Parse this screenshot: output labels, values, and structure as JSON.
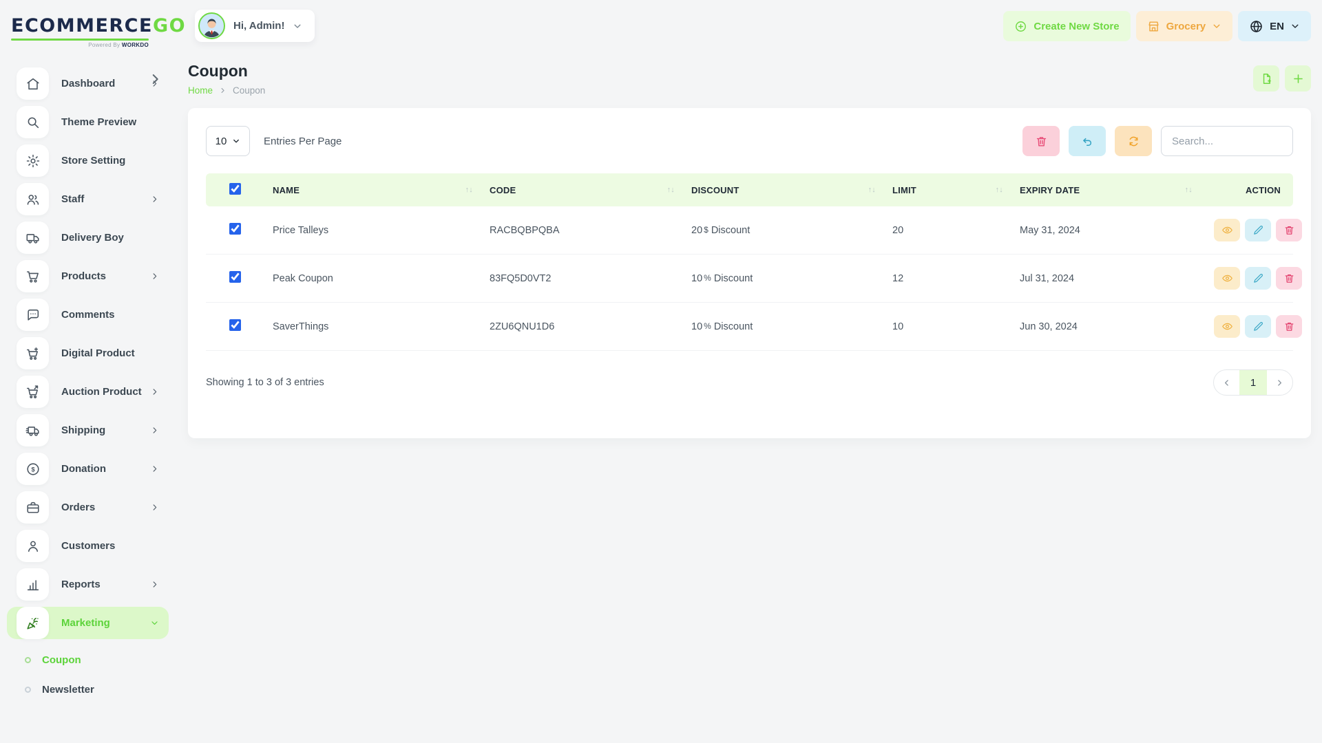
{
  "brand": {
    "name_primary": "ECOMMERCE",
    "name_accent": "GO",
    "powered_prefix": "Powered By ",
    "powered_name": "WORKDO"
  },
  "topbar": {
    "greeting": "Hi, Admin!",
    "create_store_label": "Create New Store",
    "store_selector_label": "Grocery",
    "language_label": "EN"
  },
  "sidebar": {
    "items": [
      {
        "label": "Dashboard",
        "icon": "home",
        "chevron": true,
        "active": false
      },
      {
        "label": "Theme Preview",
        "icon": "search",
        "chevron": false,
        "active": false
      },
      {
        "label": "Store Setting",
        "icon": "gear",
        "chevron": false,
        "active": false
      },
      {
        "label": "Staff",
        "icon": "users",
        "chevron": true,
        "active": false
      },
      {
        "label": "Delivery Boy",
        "icon": "truck",
        "chevron": false,
        "active": false
      },
      {
        "label": "Products",
        "icon": "cart",
        "chevron": true,
        "active": false
      },
      {
        "label": "Comments",
        "icon": "chat",
        "chevron": false,
        "active": false
      },
      {
        "label": "Digital Product",
        "icon": "cart-plus",
        "chevron": false,
        "active": false
      },
      {
        "label": "Auction Product",
        "icon": "cart-arrow",
        "chevron": true,
        "active": false
      },
      {
        "label": "Shipping",
        "icon": "truck-fast",
        "chevron": true,
        "active": false
      },
      {
        "label": "Donation",
        "icon": "dollar-circle",
        "chevron": true,
        "active": false
      },
      {
        "label": "Orders",
        "icon": "briefcase",
        "chevron": true,
        "active": false
      },
      {
        "label": "Customers",
        "icon": "user",
        "chevron": false,
        "active": false
      },
      {
        "label": "Reports",
        "icon": "bar-chart",
        "chevron": true,
        "active": false
      },
      {
        "label": "Marketing",
        "icon": "party",
        "chevron": true,
        "active": true
      }
    ],
    "subitems": [
      {
        "label": "Coupon",
        "active": true
      },
      {
        "label": "Newsletter",
        "active": false
      }
    ]
  },
  "page": {
    "title": "Coupon",
    "breadcrumb_home": "Home",
    "breadcrumb_current": "Coupon"
  },
  "toolbar": {
    "entries_value": "10",
    "entries_label": "Entries Per Page",
    "search_placeholder": "Search..."
  },
  "table": {
    "headers": [
      {
        "label": "NAME",
        "sortable": true
      },
      {
        "label": "CODE",
        "sortable": true
      },
      {
        "label": "DISCOUNT",
        "sortable": true
      },
      {
        "label": "LIMIT",
        "sortable": true
      },
      {
        "label": "EXPIRY DATE",
        "sortable": true
      },
      {
        "label": "ACTION",
        "sortable": false
      }
    ],
    "rows": [
      {
        "name": "Price Talleys",
        "code": "RACBQBPQBA",
        "discount_value": "20",
        "discount_symbol": "$",
        "discount_text": "Discount",
        "limit": "20",
        "expiry": "May 31, 2024"
      },
      {
        "name": "Peak Coupon",
        "code": "83FQ5D0VT2",
        "discount_value": "10",
        "discount_symbol": "%",
        "discount_text": "Discount",
        "limit": "12",
        "expiry": "Jul 31, 2024"
      },
      {
        "name": "SaverThings",
        "code": "2ZU6QNU1D6",
        "discount_value": "10",
        "discount_symbol": "%",
        "discount_text": "Discount",
        "limit": "10",
        "expiry": "Jun 30, 2024"
      }
    ]
  },
  "footer": {
    "showing_text": "Showing 1 to 3 of 3 entries",
    "current_page": "1"
  },
  "colors": {
    "accent_green": "#6fd943",
    "light_green": "#e9fbdc",
    "table_header_green": "#edfbe2",
    "navy": "#1c2a4b",
    "danger_pink": "#e84c77",
    "info_cyan": "#35a4c4",
    "warn_orange": "#f0a228"
  }
}
